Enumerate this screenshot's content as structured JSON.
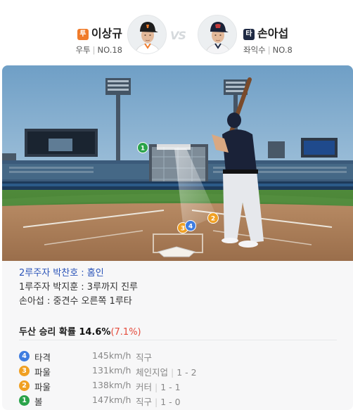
{
  "matchup": {
    "pitcher": {
      "role": "투",
      "role_color": "#f07b2a",
      "name": "이상규",
      "hand": "우투",
      "number": "NO.18"
    },
    "vs": "VS",
    "batter": {
      "role": "타",
      "role_color": "#1f2a44",
      "name": "손아섭",
      "hand": "좌익수",
      "number": "NO.8"
    }
  },
  "field_markers": [
    {
      "label": "1",
      "color": "#2aa34a"
    },
    {
      "label": "2",
      "color": "#f0a023"
    },
    {
      "label": "3",
      "color": "#f0a023"
    },
    {
      "label": "4",
      "color": "#3f7de0"
    }
  ],
  "events": [
    "2루주자 박찬호 : 홈인",
    "1루주자 박지훈 : 3루까지 진루",
    "손아섭 : 중견수 오른쪽 1루타"
  ],
  "win_prob": {
    "label": "두산 승리 확률",
    "value": "14.6%",
    "delta": "(7.1%)"
  },
  "pitches": [
    {
      "num": "4",
      "color": "#3f7de0",
      "result": "타격",
      "speed": "145km/h",
      "type": "직구",
      "count": ""
    },
    {
      "num": "3",
      "color": "#f0a023",
      "result": "파울",
      "speed": "131km/h",
      "type": "체인지업",
      "count": "1 - 2"
    },
    {
      "num": "2",
      "color": "#f0a023",
      "result": "파울",
      "speed": "138km/h",
      "type": "커터",
      "count": "1 - 1"
    },
    {
      "num": "1",
      "color": "#2aa34a",
      "result": "볼",
      "speed": "147km/h",
      "type": "직구",
      "count": "1 - 0"
    }
  ]
}
